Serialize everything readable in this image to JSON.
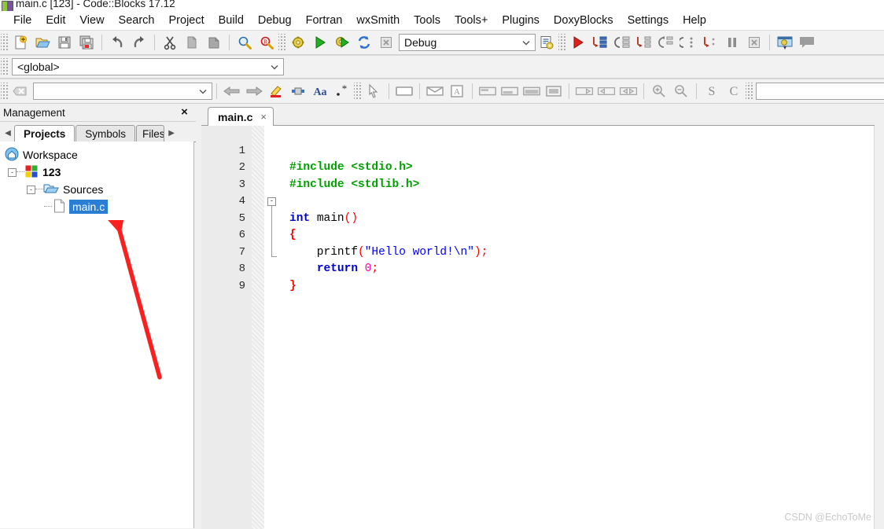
{
  "window": {
    "title": "main.c [123] - Code::Blocks 17.12",
    "app_icon": "codeblocks-icon"
  },
  "menubar": {
    "items": [
      {
        "label": "File"
      },
      {
        "label": "Edit"
      },
      {
        "label": "View"
      },
      {
        "label": "Search"
      },
      {
        "label": "Project"
      },
      {
        "label": "Build"
      },
      {
        "label": "Debug"
      },
      {
        "label": "Fortran"
      },
      {
        "label": "wxSmith"
      },
      {
        "label": "Tools"
      },
      {
        "label": "Tools+"
      },
      {
        "label": "Plugins"
      },
      {
        "label": "DoxyBlocks"
      },
      {
        "label": "Settings"
      },
      {
        "label": "Help"
      }
    ]
  },
  "toolbar_main": {
    "buttons": [
      {
        "name": "new-file-icon",
        "tooltip": "New file"
      },
      {
        "name": "open-file-icon",
        "tooltip": "Open"
      },
      {
        "name": "save-icon",
        "tooltip": "Save"
      },
      {
        "name": "save-all-icon",
        "tooltip": "Save all files"
      },
      {
        "name": "undo-icon",
        "tooltip": "Undo"
      },
      {
        "name": "redo-icon",
        "tooltip": "Redo"
      },
      {
        "name": "cut-icon",
        "tooltip": "Cut"
      },
      {
        "name": "copy-icon",
        "tooltip": "Copy"
      },
      {
        "name": "paste-icon",
        "tooltip": "Paste"
      },
      {
        "name": "find-icon",
        "tooltip": "Find"
      },
      {
        "name": "replace-icon",
        "tooltip": "Replace"
      }
    ]
  },
  "toolbar_build": {
    "buttons": [
      {
        "name": "build-icon",
        "tooltip": "Build"
      },
      {
        "name": "run-icon",
        "tooltip": "Run"
      },
      {
        "name": "build-and-run-icon",
        "tooltip": "Build and run"
      },
      {
        "name": "rebuild-icon",
        "tooltip": "Rebuild"
      },
      {
        "name": "abort-icon",
        "tooltip": "Abort"
      }
    ],
    "target_select": {
      "value": "Debug",
      "placeholder": "Build target"
    },
    "target_options_icon": "build-target-options-icon"
  },
  "toolbar_debug": {
    "buttons": [
      {
        "name": "debug-continue-icon",
        "tooltip": "Debug / Continue"
      },
      {
        "name": "run-to-cursor-icon",
        "tooltip": "Run to cursor"
      },
      {
        "name": "next-line-icon",
        "tooltip": "Next line"
      },
      {
        "name": "step-into-icon",
        "tooltip": "Step into"
      },
      {
        "name": "step-out-icon",
        "tooltip": "Step out"
      },
      {
        "name": "next-instruction-icon",
        "tooltip": "Next instruction"
      },
      {
        "name": "step-into-instruction-icon",
        "tooltip": "Step into instruction"
      },
      {
        "name": "break-debugger-icon",
        "tooltip": "Break debugger"
      },
      {
        "name": "stop-debugger-icon",
        "tooltip": "Stop debugger"
      },
      {
        "name": "debugging-windows-icon",
        "tooltip": "Debugging windows"
      },
      {
        "name": "various-info-icon",
        "tooltip": "Various info"
      }
    ]
  },
  "toolbar_scope": {
    "scope_select": {
      "value": "<global>",
      "placeholder": "Scope"
    }
  },
  "toolbar_search": {
    "close_icon": "clear-icon",
    "search_input": {
      "value": "",
      "placeholder": ""
    },
    "buttons": [
      {
        "name": "goto-previous-icon",
        "tooltip": "Go back"
      },
      {
        "name": "goto-next-icon",
        "tooltip": "Go forward"
      },
      {
        "name": "highlight-icon",
        "tooltip": "Highlight occurrences"
      },
      {
        "name": "bookmark-icon",
        "tooltip": "Toggle bookmark"
      },
      {
        "name": "match-case-icon",
        "label": "Aa",
        "tooltip": "Match case"
      },
      {
        "name": "regex-icon",
        "label": ".*",
        "tooltip": "Regular expression"
      }
    ]
  },
  "toolbar_wxsmith": {
    "buttons": [
      {
        "name": "pointer-icon",
        "tooltip": "Select"
      },
      {
        "name": "panel-icon",
        "tooltip": "Panel"
      },
      {
        "name": "dialog-icon",
        "tooltip": "Dialog"
      },
      {
        "name": "image-icon",
        "tooltip": "Image"
      },
      {
        "name": "align-top-icon",
        "tooltip": "Align top"
      },
      {
        "name": "align-bottom-icon",
        "tooltip": "Align bottom"
      },
      {
        "name": "align-fill-icon",
        "tooltip": "Fill"
      },
      {
        "name": "expand-icon",
        "tooltip": "Expand"
      },
      {
        "name": "stretch-right-icon",
        "tooltip": "Stretch right"
      },
      {
        "name": "stretch-left-icon",
        "tooltip": "Stretch left"
      },
      {
        "name": "stretch-both-icon",
        "tooltip": "Stretch both"
      },
      {
        "name": "zoom-in-icon",
        "tooltip": "Zoom in"
      },
      {
        "name": "zoom-out-icon",
        "tooltip": "Zoom out"
      },
      {
        "name": "symbol-s-icon",
        "label": "S",
        "tooltip": "S"
      },
      {
        "name": "symbol-c-icon",
        "label": "C",
        "tooltip": "C"
      }
    ],
    "right_select": {
      "value": "",
      "placeholder": ""
    },
    "right_search_icon": "search-options-icon"
  },
  "management": {
    "title": "Management",
    "close_label": "×",
    "tabs": {
      "prev_arrow": "◀",
      "next_arrow": "▶",
      "items": [
        {
          "label": "Projects",
          "active": true
        },
        {
          "label": "Symbols",
          "active": false
        },
        {
          "label": "Files",
          "active": false
        }
      ]
    },
    "tree": [
      {
        "label": "Workspace",
        "icon": "workspace-icon",
        "level": 0,
        "bold": false,
        "selected": false,
        "expander": null
      },
      {
        "label": "123",
        "icon": "project-icon",
        "level": 1,
        "bold": true,
        "selected": false,
        "expander": "-"
      },
      {
        "label": "Sources",
        "icon": "folder-icon",
        "level": 2,
        "bold": false,
        "selected": false,
        "expander": "-"
      },
      {
        "label": "main.c",
        "icon": "file-icon",
        "level": 3,
        "bold": false,
        "selected": true,
        "expander": null
      }
    ]
  },
  "editor": {
    "tabs": [
      {
        "label": "main.c",
        "close_label": "×",
        "active": true
      }
    ],
    "lines": [
      {
        "num": "1",
        "tokens": [
          {
            "t": "#include <stdio.h>",
            "c": "pre"
          }
        ]
      },
      {
        "num": "2",
        "tokens": [
          {
            "t": "#include <stdlib.h>",
            "c": "pre"
          }
        ]
      },
      {
        "num": "3",
        "tokens": []
      },
      {
        "num": "4",
        "tokens": [
          {
            "t": "int",
            "c": "kw"
          },
          {
            "t": " ",
            "c": "ident"
          },
          {
            "t": "main",
            "c": "ident"
          },
          {
            "t": "()",
            "c": "paren"
          }
        ]
      },
      {
        "num": "5",
        "tokens": [
          {
            "t": "{",
            "c": "brace"
          }
        ]
      },
      {
        "num": "6",
        "tokens": [
          {
            "t": "    printf",
            "c": "ident"
          },
          {
            "t": "(",
            "c": "paren"
          },
          {
            "t": "\"Hello world!\\n\"",
            "c": "str"
          },
          {
            "t": ")",
            "c": "paren"
          },
          {
            "t": ";",
            "c": "punc"
          }
        ]
      },
      {
        "num": "7",
        "tokens": [
          {
            "t": "    ",
            "c": "ident"
          },
          {
            "t": "return",
            "c": "kw"
          },
          {
            "t": " ",
            "c": "ident"
          },
          {
            "t": "0",
            "c": "num-lit"
          },
          {
            "t": ";",
            "c": "punc"
          }
        ]
      },
      {
        "num": "8",
        "tokens": [
          {
            "t": "}",
            "c": "brace"
          }
        ]
      },
      {
        "num": "9",
        "tokens": []
      }
    ],
    "fold_marker": "-"
  },
  "annotation": {
    "name": "red-arrow-pointing-to-main-c",
    "color": "#fb2020",
    "points_at": "main.c"
  },
  "watermark": {
    "text": "CSDN @EchoToMe"
  },
  "colors": {
    "selection_blue": "#2a7fd4",
    "keyword_blue": "#0000d2",
    "preprocessor_green": "#00a000",
    "string_blue": "#0000ff",
    "brace_red": "#ff0000",
    "number_pink": "#ff00aa",
    "annotation_red": "#fb2020"
  }
}
